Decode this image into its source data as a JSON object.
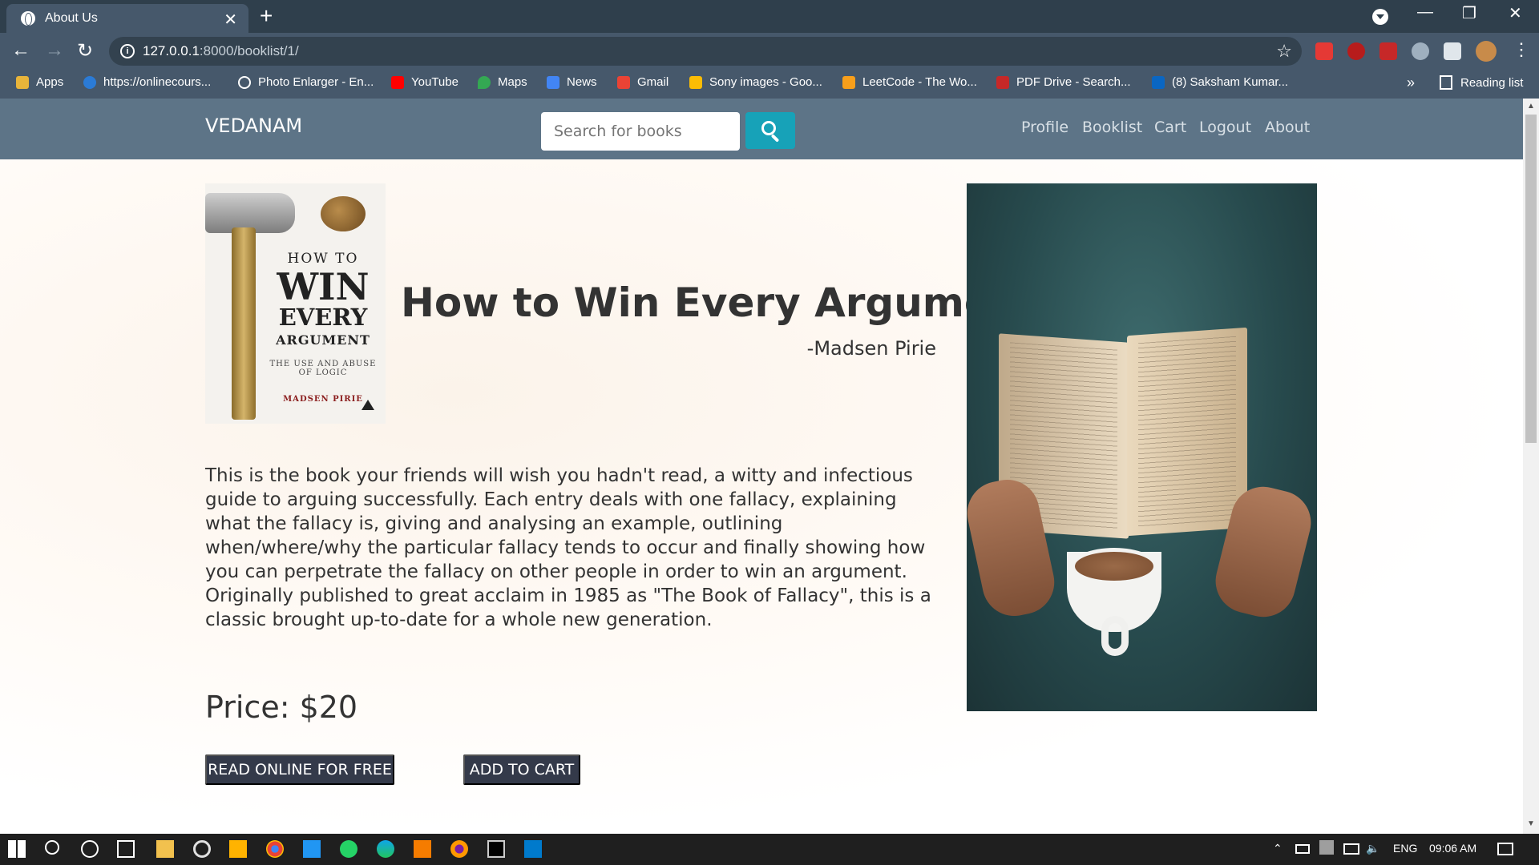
{
  "browser": {
    "tab_title": "About Us",
    "tab_close": "✕",
    "new_tab": "+",
    "url_host": "127.0.0.1",
    "url_path": ":8000/booklist/1/",
    "bookmarks": [
      {
        "label": "Apps",
        "icon": "apps-grid-icon",
        "color": "#e8b43a"
      },
      {
        "label": "https://onlinecours...",
        "icon": "edge-icon",
        "color": "#2b7bd6"
      },
      {
        "label": "Photo Enlarger - En...",
        "icon": "magnifier-icon",
        "color": "#ffffff"
      },
      {
        "label": "YouTube",
        "icon": "youtube-icon",
        "color": "#ff0000"
      },
      {
        "label": "Maps",
        "icon": "maps-pin-icon",
        "color": "#34a853"
      },
      {
        "label": "News",
        "icon": "news-icon",
        "color": "#4285f4"
      },
      {
        "label": "Gmail",
        "icon": "gmail-icon",
        "color": "#ea4335"
      },
      {
        "label": "Sony images - Goo...",
        "icon": "drive-icon",
        "color": "#fbbc04"
      },
      {
        "label": "LeetCode - The Wo...",
        "icon": "leetcode-icon",
        "color": "#f89f1b"
      },
      {
        "label": "PDF Drive - Search...",
        "icon": "pdf-icon",
        "color": "#c62828"
      },
      {
        "label": "(8) Saksham Kumar...",
        "icon": "linkedin-icon",
        "color": "#0a66c2"
      }
    ],
    "bookmarks_more": "»",
    "reading_list": "Reading list"
  },
  "site": {
    "brand": "VEDANAM",
    "search_placeholder": "Search for books",
    "nav": [
      "Profile",
      "Booklist",
      "Cart",
      "Logout",
      "About"
    ]
  },
  "book": {
    "cover": {
      "line1": "HOW TO",
      "line2": "WIN",
      "line3": "EVERY",
      "line4": "ARGUMENT",
      "line5": "THE USE AND ABUSE OF LOGIC",
      "line6": "MADSEN PIRIE"
    },
    "title": "How to Win Every Argument",
    "author": "-Madsen Pirie",
    "description": "This is the book your friends will wish you hadn't read, a witty and infectious guide to arguing successfully. Each entry deals with one fallacy, explaining what the fallacy is, giving and analysing an example, outlining when/where/why the particular fallacy tends to occur and finally showing how you can perpetrate the fallacy on other people in order to win an argument. Originally published to great acclaim in 1985 as \"The Book of Fallacy\", this is a classic brought up-to-date for a whole new generation.",
    "price": "Price: $20",
    "read_button": "READ ONLINE FOR FREE",
    "cart_button": "ADD TO CART"
  },
  "taskbar": {
    "language": "ENG",
    "time": "09:06 AM"
  },
  "colors": {
    "navbar": "#5d7487",
    "search_button": "#17a2b8",
    "action_button": "#343a4a"
  }
}
